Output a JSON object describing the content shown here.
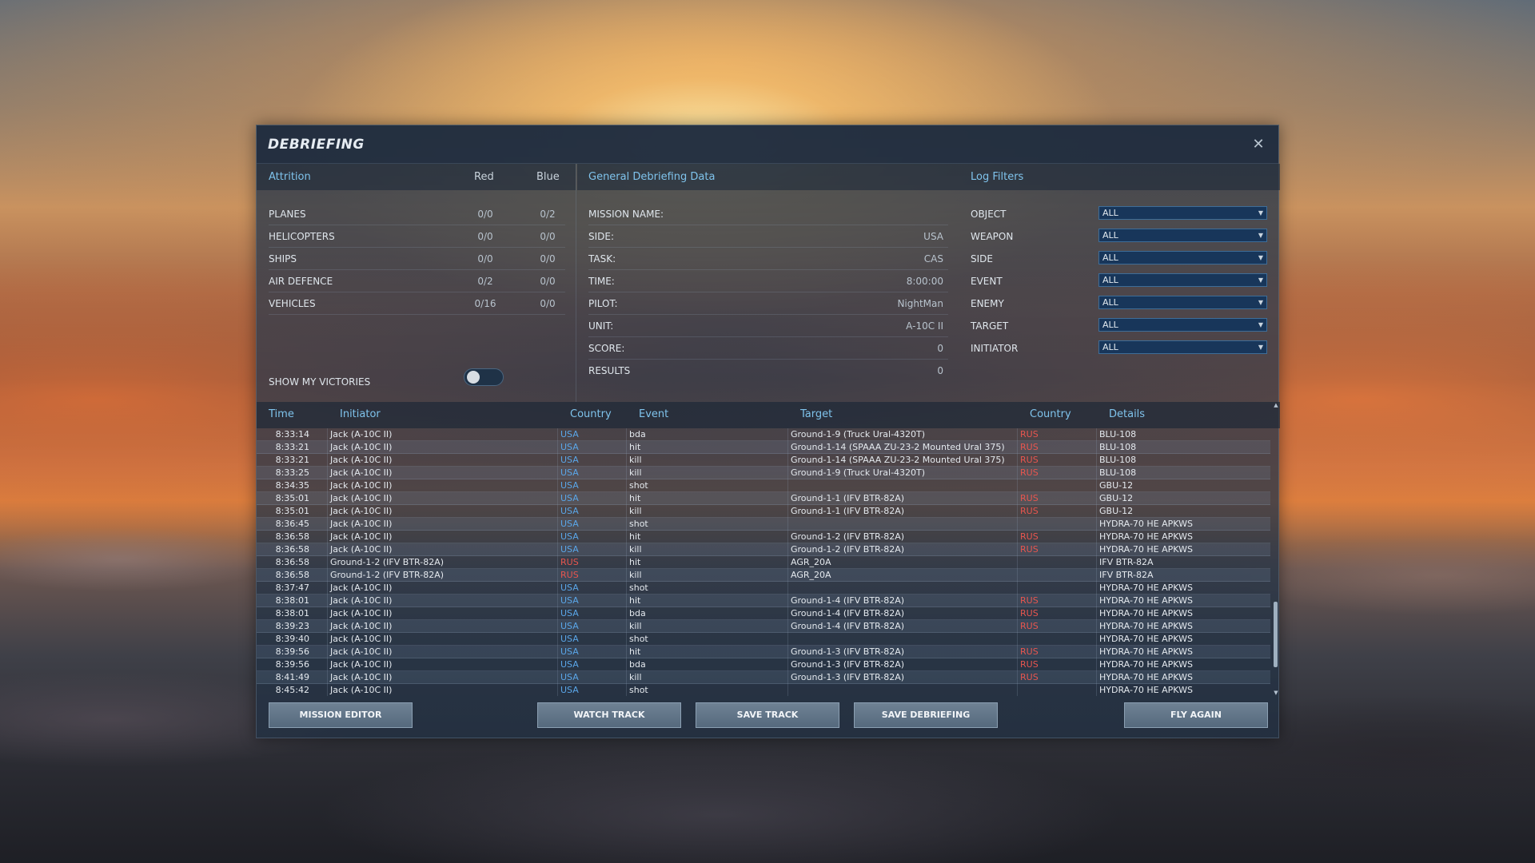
{
  "dialog": {
    "title": "DEBRIEFING"
  },
  "attrition": {
    "header": "Attrition",
    "col_red": "Red",
    "col_blue": "Blue",
    "rows": [
      {
        "label": "PLANES",
        "red": "0/0",
        "blue": "0/2"
      },
      {
        "label": "HELICOPTERS",
        "red": "0/0",
        "blue": "0/0"
      },
      {
        "label": "SHIPS",
        "red": "0/0",
        "blue": "0/0"
      },
      {
        "label": "AIR DEFENCE",
        "red": "0/2",
        "blue": "0/0"
      },
      {
        "label": "VEHICLES",
        "red": "0/16",
        "blue": "0/0"
      }
    ],
    "show_victories_label": "SHOW MY VICTORIES",
    "show_victories_on": false
  },
  "general": {
    "header": "General Debriefing Data",
    "rows": [
      {
        "label": "MISSION NAME:",
        "value": ""
      },
      {
        "label": "SIDE:",
        "value": "USA"
      },
      {
        "label": "TASK:",
        "value": "CAS"
      },
      {
        "label": "TIME:",
        "value": "8:00:00"
      },
      {
        "label": "PILOT:",
        "value": "NightMan"
      },
      {
        "label": "UNIT:",
        "value": "A-10C II"
      },
      {
        "label": "SCORE:",
        "value": "0"
      },
      {
        "label": "RESULTS",
        "value": "0"
      }
    ]
  },
  "filters": {
    "header": "Log Filters",
    "rows": [
      {
        "label": "OBJECT",
        "value": "ALL"
      },
      {
        "label": "WEAPON",
        "value": "ALL"
      },
      {
        "label": "SIDE",
        "value": "ALL"
      },
      {
        "label": "EVENT",
        "value": "ALL"
      },
      {
        "label": "ENEMY",
        "value": "ALL"
      },
      {
        "label": "TARGET",
        "value": "ALL"
      },
      {
        "label": "INITIATOR",
        "value": "ALL"
      }
    ]
  },
  "log": {
    "headers": {
      "time": "Time",
      "initiator": "Initiator",
      "country": "Country",
      "event": "Event",
      "target": "Target",
      "target_country": "Country",
      "details": "Details"
    },
    "rows": [
      {
        "time": "8:33:14",
        "initiator": "Jack (A-10C II)",
        "country": "USA",
        "event": "bda",
        "target": "Ground-1-9 (Truck Ural-4320T)",
        "target_country": "RUS",
        "details": "BLU-108"
      },
      {
        "time": "8:33:21",
        "initiator": "Jack (A-10C II)",
        "country": "USA",
        "event": "hit",
        "target": "Ground-1-14 (SPAAA ZU-23-2 Mounted Ural 375)",
        "target_country": "RUS",
        "details": "BLU-108"
      },
      {
        "time": "8:33:21",
        "initiator": "Jack (A-10C II)",
        "country": "USA",
        "event": "kill",
        "target": "Ground-1-14 (SPAAA ZU-23-2 Mounted Ural 375)",
        "target_country": "RUS",
        "details": "BLU-108"
      },
      {
        "time": "8:33:25",
        "initiator": "Jack (A-10C II)",
        "country": "USA",
        "event": "kill",
        "target": "Ground-1-9 (Truck Ural-4320T)",
        "target_country": "RUS",
        "details": "BLU-108"
      },
      {
        "time": "8:34:35",
        "initiator": "Jack (A-10C II)",
        "country": "USA",
        "event": "shot",
        "target": "",
        "target_country": "",
        "details": "GBU-12"
      },
      {
        "time": "8:35:01",
        "initiator": "Jack (A-10C II)",
        "country": "USA",
        "event": "hit",
        "target": "Ground-1-1 (IFV BTR-82A)",
        "target_country": "RUS",
        "details": "GBU-12"
      },
      {
        "time": "8:35:01",
        "initiator": "Jack (A-10C II)",
        "country": "USA",
        "event": "kill",
        "target": "Ground-1-1 (IFV BTR-82A)",
        "target_country": "RUS",
        "details": "GBU-12"
      },
      {
        "time": "8:36:45",
        "initiator": "Jack (A-10C II)",
        "country": "USA",
        "event": "shot",
        "target": "",
        "target_country": "",
        "details": "HYDRA-70 HE APKWS"
      },
      {
        "time": "8:36:58",
        "initiator": "Jack (A-10C II)",
        "country": "USA",
        "event": "hit",
        "target": "Ground-1-2 (IFV BTR-82A)",
        "target_country": "RUS",
        "details": "HYDRA-70 HE APKWS"
      },
      {
        "time": "8:36:58",
        "initiator": "Jack (A-10C II)",
        "country": "USA",
        "event": "kill",
        "target": "Ground-1-2 (IFV BTR-82A)",
        "target_country": "RUS",
        "details": "HYDRA-70 HE APKWS"
      },
      {
        "time": "8:36:58",
        "initiator": "Ground-1-2 (IFV BTR-82A)",
        "country": "RUS",
        "event": "hit",
        "target": "AGR_20A",
        "target_country": "",
        "details": "IFV BTR-82A"
      },
      {
        "time": "8:36:58",
        "initiator": "Ground-1-2 (IFV BTR-82A)",
        "country": "RUS",
        "event": "kill",
        "target": "AGR_20A",
        "target_country": "",
        "details": "IFV BTR-82A"
      },
      {
        "time": "8:37:47",
        "initiator": "Jack (A-10C II)",
        "country": "USA",
        "event": "shot",
        "target": "",
        "target_country": "",
        "details": "HYDRA-70 HE APKWS"
      },
      {
        "time": "8:38:01",
        "initiator": "Jack (A-10C II)",
        "country": "USA",
        "event": "hit",
        "target": "Ground-1-4 (IFV BTR-82A)",
        "target_country": "RUS",
        "details": "HYDRA-70 HE APKWS"
      },
      {
        "time": "8:38:01",
        "initiator": "Jack (A-10C II)",
        "country": "USA",
        "event": "bda",
        "target": "Ground-1-4 (IFV BTR-82A)",
        "target_country": "RUS",
        "details": "HYDRA-70 HE APKWS"
      },
      {
        "time": "8:39:23",
        "initiator": "Jack (A-10C II)",
        "country": "USA",
        "event": "kill",
        "target": "Ground-1-4 (IFV BTR-82A)",
        "target_country": "RUS",
        "details": "HYDRA-70 HE APKWS"
      },
      {
        "time": "8:39:40",
        "initiator": "Jack (A-10C II)",
        "country": "USA",
        "event": "shot",
        "target": "",
        "target_country": "",
        "details": "HYDRA-70 HE APKWS"
      },
      {
        "time": "8:39:56",
        "initiator": "Jack (A-10C II)",
        "country": "USA",
        "event": "hit",
        "target": "Ground-1-3 (IFV BTR-82A)",
        "target_country": "RUS",
        "details": "HYDRA-70 HE APKWS"
      },
      {
        "time": "8:39:56",
        "initiator": "Jack (A-10C II)",
        "country": "USA",
        "event": "bda",
        "target": "Ground-1-3 (IFV BTR-82A)",
        "target_country": "RUS",
        "details": "HYDRA-70 HE APKWS"
      },
      {
        "time": "8:41:49",
        "initiator": "Jack (A-10C II)",
        "country": "USA",
        "event": "kill",
        "target": "Ground-1-3 (IFV BTR-82A)",
        "target_country": "RUS",
        "details": "HYDRA-70 HE APKWS"
      },
      {
        "time": "8:45:42",
        "initiator": "Jack (A-10C II)",
        "country": "USA",
        "event": "shot",
        "target": "",
        "target_country": "",
        "details": "HYDRA-70 HE APKWS"
      }
    ]
  },
  "buttons": {
    "mission_editor": "MISSION EDITOR",
    "watch_track": "WATCH TRACK",
    "save_track": "SAVE TRACK",
    "save_debriefing": "SAVE DEBRIEFING",
    "fly_again": "FLY AGAIN"
  },
  "colors": {
    "accent": "#7fc3ec",
    "usa": "#5aa6e8",
    "rus": "#e8564f"
  }
}
